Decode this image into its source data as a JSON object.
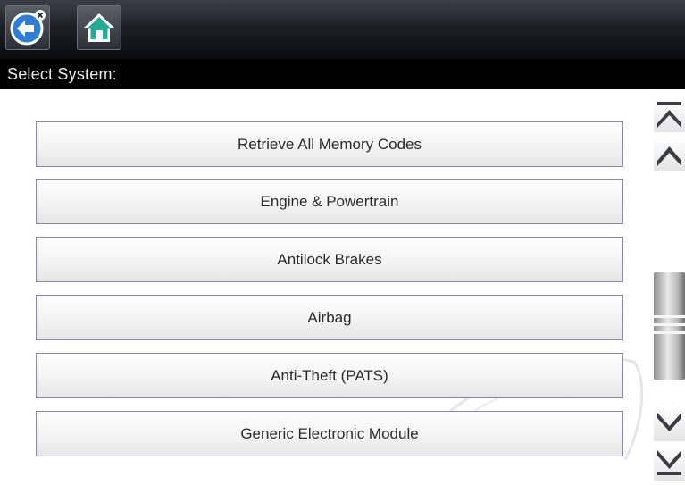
{
  "header": {
    "back_icon": "back-arrow-icon",
    "home_icon": "home-icon",
    "subtitle": "Select System:"
  },
  "menu": {
    "items": [
      {
        "label": "Retrieve All Memory Codes"
      },
      {
        "label": "Engine & Powertrain"
      },
      {
        "label": "Antilock Brakes"
      },
      {
        "label": "Airbag"
      },
      {
        "label": "Anti-Theft (PATS)"
      },
      {
        "label": "Generic Electronic Module"
      }
    ]
  },
  "scrollbar": {
    "top_icon": "scroll-to-top-icon",
    "up_icon": "scroll-up-icon",
    "down_icon": "scroll-down-icon",
    "bottom_icon": "scroll-to-bottom-icon"
  },
  "colors": {
    "toolbar": "#1d2026",
    "subtitle_bar": "#000000",
    "item_border": "#8c84b8",
    "back_button": "#2d7fd6",
    "home_button": "#27a99a"
  }
}
